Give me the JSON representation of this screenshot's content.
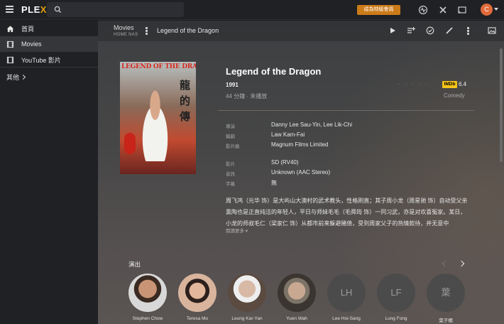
{
  "app": {
    "logo": "PLEX"
  },
  "search": {
    "placeholder": ""
  },
  "topbar": {
    "premium_label": "成為特級會員",
    "avatar_initial": "C"
  },
  "icons": {
    "menu": "hamburger-icon",
    "search": "search-icon",
    "activity": "activity-icon",
    "settings": "tools-icon",
    "cast": "cast-icon"
  },
  "sidebar": {
    "items": [
      {
        "label": "首頁",
        "icon": "home-icon"
      },
      {
        "label": "Movies",
        "icon": "film-icon"
      },
      {
        "label": "YouTube 影片",
        "icon": "film-icon"
      }
    ],
    "more_label": "其他"
  },
  "toolbar": {
    "library": "Movies",
    "server": "HOME NAS",
    "title": "Legend of the Dragon"
  },
  "poster": {
    "title_text": "LEGEND OF THE DRAGON",
    "chinese": "龍的傳"
  },
  "movie": {
    "title": "Legend of the Dragon",
    "year": "1991",
    "duration": "44 分鐘 · 未播放",
    "rating_stars": "· · · · ·",
    "imdb_label": "IMDb",
    "imdb_rating": "6.4",
    "genre": "Comedy"
  },
  "details": [
    {
      "label": "導演",
      "value": "Danny Lee Sau-Yin, Lee Lik-Chi"
    },
    {
      "label": "編劇",
      "value": "Law Kam-Fai"
    },
    {
      "label": "影片廠",
      "value": "Magnum Films Limited"
    },
    {
      "label": "影片",
      "value": "SD (RV40)"
    },
    {
      "label": "音訊",
      "value": "Unknown (AAC Stereo)"
    },
    {
      "label": "字幕",
      "value": "無"
    }
  ],
  "synopsis": "周飞鸿（元华 饰）是大屿山大澳村的武术教头，性格刚直；其子周小龙（周星驰 饰）自动受父亲熏陶也是正直纯洁的年轻人，平日与师妹毛毛（毛舜筠 饰）一同习武，亦是对欢喜冤家。某日，小龙的师叔毛仁（梁家仁 饰）从都市前来躲避赌债，受到周家父子的热情款待，并无意中",
  "read_more": "閱讀更多",
  "cast": {
    "heading": "演出",
    "members": [
      {
        "name": "Stephen Chow",
        "initials": ""
      },
      {
        "name": "Teresa Mo",
        "initials": ""
      },
      {
        "name": "Leung Kar-Yan",
        "initials": ""
      },
      {
        "name": "Yuen Wah",
        "initials": ""
      },
      {
        "name": "Lee Hoi-Sang",
        "initials": "LH"
      },
      {
        "name": "Lung Fong",
        "initials": "LF"
      },
      {
        "name": "葉子楣",
        "initials": "葉"
      }
    ]
  },
  "colors": {
    "accent": "#e5a00d",
    "premium": "#cc7b19",
    "imdb": "#f5c518"
  }
}
